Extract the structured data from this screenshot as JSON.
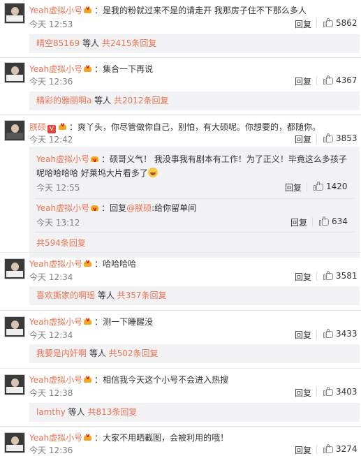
{
  "comments": [
    {
      "user": "Yeah虚拟小号",
      "text": "：是我的粉就过来不是的请走开 我那房子住不下那么多人",
      "time": "今天 12:53",
      "reply": "回复",
      "likes": "5862",
      "more_user": "晴空85169",
      "more_mid": " 等人 ",
      "more_count": "共2415条回复"
    },
    {
      "user": "Yeah虚拟小号",
      "text": "：集合一下再说",
      "time": "今天 12:36",
      "reply": "回复",
      "likes": "4367",
      "more_user": "精彩的雅丽啊a",
      "more_mid": " 等人 ",
      "more_count": "共2012条回复"
    },
    {
      "user": "朕硕",
      "text": "：爽丫头，你尽管做你自己，别怕，有大硕呢。你想要的，都随你。",
      "time": "今天 12:42",
      "reply": "回复",
      "likes": "3853",
      "subs": [
        {
          "user": "Yeah虚拟小号",
          "text": "：硕哥义气！ 我没事我有剧本有工作！为了正义！毕竟这么多孩子呢哈哈哈哈 好莱坞大片看多了",
          "time": "今天 12:55",
          "reply": "回复",
          "likes": "1420"
        },
        {
          "user": "Yeah虚拟小号",
          "text_pre": "：回复",
          "mention": "@朕硕",
          "text": ":给你留单间",
          "time": "今天 13:12",
          "reply": "回复",
          "likes": "634"
        }
      ],
      "more_count": "共594条回复"
    },
    {
      "user": "Yeah虚拟小号",
      "text": "：哈哈哈哈",
      "time": "今天 12:34",
      "reply": "回复",
      "likes": "3581",
      "more_user": "喜欢撕家的啊瑶",
      "more_mid": " 等人 ",
      "more_count": "共357条回复"
    },
    {
      "user": "Yeah虚拟小号",
      "text": "：测一下睡醒没",
      "time": "今天 12:34",
      "reply": "回复",
      "likes": "3433",
      "more_user": "我要是内奸啊",
      "more_mid": " 等人 ",
      "more_count": "共502条回复"
    },
    {
      "user": "Yeah虚拟小号",
      "text": "：相信我今天这个小号不会进入热搜",
      "time": "今天 12:38",
      "reply": "回复",
      "likes": "3403",
      "more_user": "lamthy",
      "more_mid": " 等人 ",
      "more_count": "共813条回复"
    },
    {
      "user": "Yeah虚拟小号",
      "text": "：大家不用晒截图，会被利用的哦！",
      "time": "今天 12:36",
      "reply": "回复",
      "likes": "3274"
    }
  ],
  "colors": {
    "link": "#eb7350",
    "muted": "#808080",
    "panel": "#f2f2f5"
  },
  "icons": {
    "like": "thumbs-up-icon",
    "vip": "crown-icon",
    "verified": "v-badge-icon"
  }
}
